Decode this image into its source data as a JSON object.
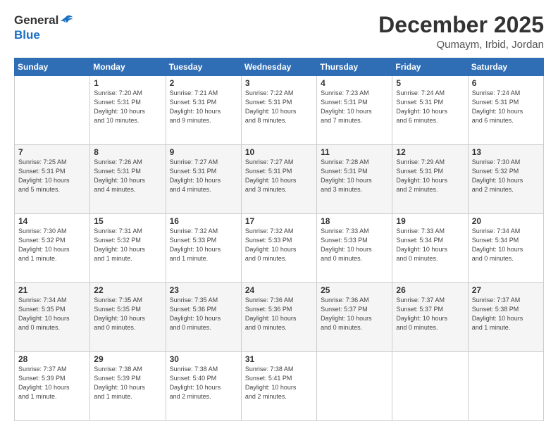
{
  "header": {
    "logo_general": "General",
    "logo_blue": "Blue",
    "month": "December 2025",
    "location": "Qumaym, Irbid, Jordan"
  },
  "days_of_week": [
    "Sunday",
    "Monday",
    "Tuesday",
    "Wednesday",
    "Thursday",
    "Friday",
    "Saturday"
  ],
  "weeks": [
    [
      {
        "day": "",
        "info": ""
      },
      {
        "day": "1",
        "info": "Sunrise: 7:20 AM\nSunset: 5:31 PM\nDaylight: 10 hours\nand 10 minutes."
      },
      {
        "day": "2",
        "info": "Sunrise: 7:21 AM\nSunset: 5:31 PM\nDaylight: 10 hours\nand 9 minutes."
      },
      {
        "day": "3",
        "info": "Sunrise: 7:22 AM\nSunset: 5:31 PM\nDaylight: 10 hours\nand 8 minutes."
      },
      {
        "day": "4",
        "info": "Sunrise: 7:23 AM\nSunset: 5:31 PM\nDaylight: 10 hours\nand 7 minutes."
      },
      {
        "day": "5",
        "info": "Sunrise: 7:24 AM\nSunset: 5:31 PM\nDaylight: 10 hours\nand 6 minutes."
      },
      {
        "day": "6",
        "info": "Sunrise: 7:24 AM\nSunset: 5:31 PM\nDaylight: 10 hours\nand 6 minutes."
      }
    ],
    [
      {
        "day": "7",
        "info": "Sunrise: 7:25 AM\nSunset: 5:31 PM\nDaylight: 10 hours\nand 5 minutes."
      },
      {
        "day": "8",
        "info": "Sunrise: 7:26 AM\nSunset: 5:31 PM\nDaylight: 10 hours\nand 4 minutes."
      },
      {
        "day": "9",
        "info": "Sunrise: 7:27 AM\nSunset: 5:31 PM\nDaylight: 10 hours\nand 4 minutes."
      },
      {
        "day": "10",
        "info": "Sunrise: 7:27 AM\nSunset: 5:31 PM\nDaylight: 10 hours\nand 3 minutes."
      },
      {
        "day": "11",
        "info": "Sunrise: 7:28 AM\nSunset: 5:31 PM\nDaylight: 10 hours\nand 3 minutes."
      },
      {
        "day": "12",
        "info": "Sunrise: 7:29 AM\nSunset: 5:31 PM\nDaylight: 10 hours\nand 2 minutes."
      },
      {
        "day": "13",
        "info": "Sunrise: 7:30 AM\nSunset: 5:32 PM\nDaylight: 10 hours\nand 2 minutes."
      }
    ],
    [
      {
        "day": "14",
        "info": "Sunrise: 7:30 AM\nSunset: 5:32 PM\nDaylight: 10 hours\nand 1 minute."
      },
      {
        "day": "15",
        "info": "Sunrise: 7:31 AM\nSunset: 5:32 PM\nDaylight: 10 hours\nand 1 minute."
      },
      {
        "day": "16",
        "info": "Sunrise: 7:32 AM\nSunset: 5:33 PM\nDaylight: 10 hours\nand 1 minute."
      },
      {
        "day": "17",
        "info": "Sunrise: 7:32 AM\nSunset: 5:33 PM\nDaylight: 10 hours\nand 0 minutes."
      },
      {
        "day": "18",
        "info": "Sunrise: 7:33 AM\nSunset: 5:33 PM\nDaylight: 10 hours\nand 0 minutes."
      },
      {
        "day": "19",
        "info": "Sunrise: 7:33 AM\nSunset: 5:34 PM\nDaylight: 10 hours\nand 0 minutes."
      },
      {
        "day": "20",
        "info": "Sunrise: 7:34 AM\nSunset: 5:34 PM\nDaylight: 10 hours\nand 0 minutes."
      }
    ],
    [
      {
        "day": "21",
        "info": "Sunrise: 7:34 AM\nSunset: 5:35 PM\nDaylight: 10 hours\nand 0 minutes."
      },
      {
        "day": "22",
        "info": "Sunrise: 7:35 AM\nSunset: 5:35 PM\nDaylight: 10 hours\nand 0 minutes."
      },
      {
        "day": "23",
        "info": "Sunrise: 7:35 AM\nSunset: 5:36 PM\nDaylight: 10 hours\nand 0 minutes."
      },
      {
        "day": "24",
        "info": "Sunrise: 7:36 AM\nSunset: 5:36 PM\nDaylight: 10 hours\nand 0 minutes."
      },
      {
        "day": "25",
        "info": "Sunrise: 7:36 AM\nSunset: 5:37 PM\nDaylight: 10 hours\nand 0 minutes."
      },
      {
        "day": "26",
        "info": "Sunrise: 7:37 AM\nSunset: 5:37 PM\nDaylight: 10 hours\nand 0 minutes."
      },
      {
        "day": "27",
        "info": "Sunrise: 7:37 AM\nSunset: 5:38 PM\nDaylight: 10 hours\nand 1 minute."
      }
    ],
    [
      {
        "day": "28",
        "info": "Sunrise: 7:37 AM\nSunset: 5:39 PM\nDaylight: 10 hours\nand 1 minute."
      },
      {
        "day": "29",
        "info": "Sunrise: 7:38 AM\nSunset: 5:39 PM\nDaylight: 10 hours\nand 1 minute."
      },
      {
        "day": "30",
        "info": "Sunrise: 7:38 AM\nSunset: 5:40 PM\nDaylight: 10 hours\nand 2 minutes."
      },
      {
        "day": "31",
        "info": "Sunrise: 7:38 AM\nSunset: 5:41 PM\nDaylight: 10 hours\nand 2 minutes."
      },
      {
        "day": "",
        "info": ""
      },
      {
        "day": "",
        "info": ""
      },
      {
        "day": "",
        "info": ""
      }
    ]
  ]
}
